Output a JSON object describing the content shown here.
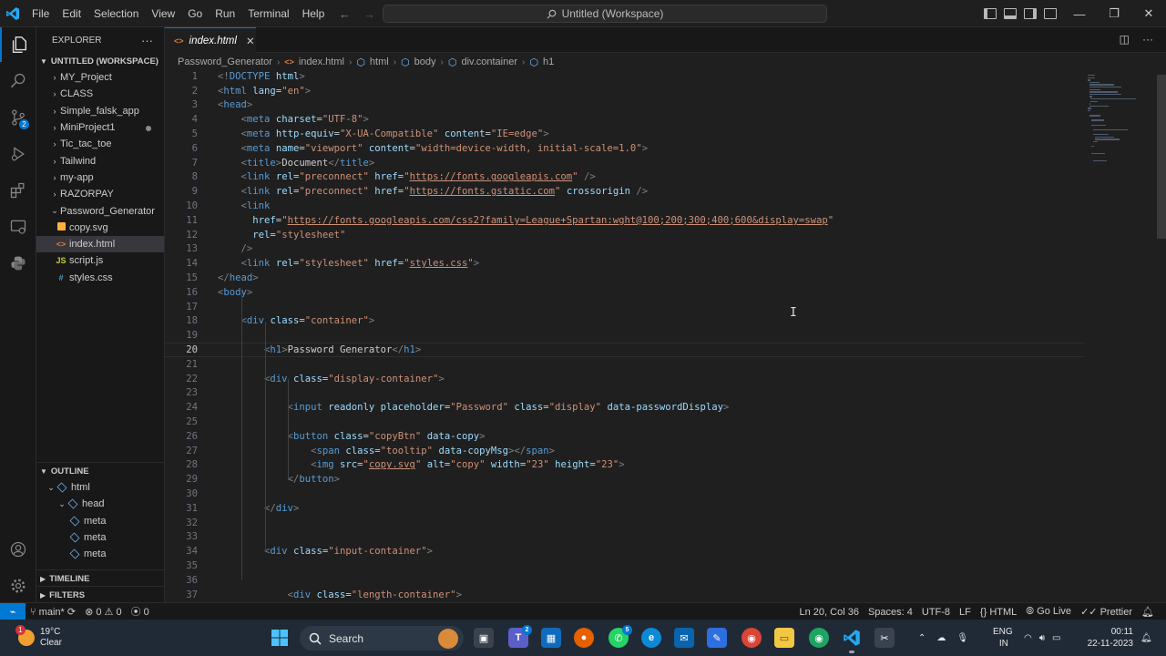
{
  "titlebar": {
    "menu": [
      "File",
      "Edit",
      "Selection",
      "View",
      "Go",
      "Run",
      "Terminal",
      "Help"
    ],
    "search_text": "Untitled (Workspace)"
  },
  "sidebar": {
    "explorer_title": "EXPLORER",
    "more": "···",
    "workspace_label": "UNTITLED (WORKSPACE)",
    "folders": [
      "MY_Project",
      "CLASS",
      "Simple_falsk_app",
      "MiniProject1",
      "Tic_tac_toe",
      "Tailwind",
      "my-app",
      "RAZORPAY"
    ],
    "open_folder": "Password_Generator",
    "files": [
      {
        "name": "copy.svg",
        "icon": "svg-icon",
        "glyph": "",
        "color": "#ffb13b"
      },
      {
        "name": "index.html",
        "icon": "html-icon",
        "glyph": "<>",
        "color": "#e37933"
      },
      {
        "name": "script.js",
        "icon": "js-icon",
        "glyph": "JS",
        "color": "#cbcb41"
      },
      {
        "name": "styles.css",
        "icon": "css-icon",
        "glyph": "#",
        "color": "#519aba"
      }
    ],
    "outline_label": "OUTLINE",
    "outline": [
      "html",
      "head",
      "meta",
      "meta",
      "meta"
    ],
    "timeline_label": "TIMELINE",
    "filters_label": "FILTERS"
  },
  "editor": {
    "tab_label": "index.html",
    "tab_close": "✕",
    "breadcrumb": [
      "Password_Generator",
      "index.html",
      "html",
      "body",
      "div.container",
      "h1"
    ],
    "current_line": 20,
    "lines": [
      [
        {
          "t": "tgb",
          "v": "<!"
        },
        {
          "t": "tg",
          "v": "DOCTYPE"
        },
        {
          "t": "tx",
          "v": " "
        },
        {
          "t": "at",
          "v": "html"
        },
        {
          "t": "tgb",
          "v": ">"
        }
      ],
      [
        {
          "t": "tgb",
          "v": "<"
        },
        {
          "t": "tg",
          "v": "html"
        },
        {
          "t": "tx",
          "v": " "
        },
        {
          "t": "at",
          "v": "lang"
        },
        {
          "t": "tx",
          "v": "="
        },
        {
          "t": "st",
          "v": "\"en\""
        },
        {
          "t": "tgb",
          "v": ">"
        }
      ],
      [
        {
          "t": "tgb",
          "v": "<"
        },
        {
          "t": "tg",
          "v": "head"
        },
        {
          "t": "tgb",
          "v": ">"
        }
      ],
      [
        {
          "t": "tx",
          "v": "    "
        },
        {
          "t": "tgb",
          "v": "<"
        },
        {
          "t": "tg",
          "v": "meta"
        },
        {
          "t": "tx",
          "v": " "
        },
        {
          "t": "at",
          "v": "charset"
        },
        {
          "t": "tx",
          "v": "="
        },
        {
          "t": "st",
          "v": "\"UTF-8\""
        },
        {
          "t": "tgb",
          "v": ">"
        }
      ],
      [
        {
          "t": "tx",
          "v": "    "
        },
        {
          "t": "tgb",
          "v": "<"
        },
        {
          "t": "tg",
          "v": "meta"
        },
        {
          "t": "tx",
          "v": " "
        },
        {
          "t": "at",
          "v": "http-equiv"
        },
        {
          "t": "tx",
          "v": "="
        },
        {
          "t": "st",
          "v": "\"X-UA-Compatible\""
        },
        {
          "t": "tx",
          "v": " "
        },
        {
          "t": "at",
          "v": "content"
        },
        {
          "t": "tx",
          "v": "="
        },
        {
          "t": "st",
          "v": "\"IE=edge\""
        },
        {
          "t": "tgb",
          "v": ">"
        }
      ],
      [
        {
          "t": "tx",
          "v": "    "
        },
        {
          "t": "tgb",
          "v": "<"
        },
        {
          "t": "tg",
          "v": "meta"
        },
        {
          "t": "tx",
          "v": " "
        },
        {
          "t": "at",
          "v": "name"
        },
        {
          "t": "tx",
          "v": "="
        },
        {
          "t": "st",
          "v": "\"viewport\""
        },
        {
          "t": "tx",
          "v": " "
        },
        {
          "t": "at",
          "v": "content"
        },
        {
          "t": "tx",
          "v": "="
        },
        {
          "t": "st",
          "v": "\"width=device-width, initial-scale=1.0\""
        },
        {
          "t": "tgb",
          "v": ">"
        }
      ],
      [
        {
          "t": "tx",
          "v": "    "
        },
        {
          "t": "tgb",
          "v": "<"
        },
        {
          "t": "tg",
          "v": "title"
        },
        {
          "t": "tgb",
          "v": ">"
        },
        {
          "t": "tx",
          "v": "Document"
        },
        {
          "t": "tgb",
          "v": "</"
        },
        {
          "t": "tg",
          "v": "title"
        },
        {
          "t": "tgb",
          "v": ">"
        }
      ],
      [
        {
          "t": "tx",
          "v": "    "
        },
        {
          "t": "tgb",
          "v": "<"
        },
        {
          "t": "tg",
          "v": "link"
        },
        {
          "t": "tx",
          "v": " "
        },
        {
          "t": "at",
          "v": "rel"
        },
        {
          "t": "tx",
          "v": "="
        },
        {
          "t": "st",
          "v": "\"preconnect\""
        },
        {
          "t": "tx",
          "v": " "
        },
        {
          "t": "at",
          "v": "href"
        },
        {
          "t": "tx",
          "v": "="
        },
        {
          "t": "st",
          "v": "\""
        },
        {
          "t": "ur",
          "v": "https://fonts.googleapis.com"
        },
        {
          "t": "st",
          "v": "\""
        },
        {
          "t": "tx",
          "v": " "
        },
        {
          "t": "tgb",
          "v": "/>"
        }
      ],
      [
        {
          "t": "tx",
          "v": "    "
        },
        {
          "t": "tgb",
          "v": "<"
        },
        {
          "t": "tg",
          "v": "link"
        },
        {
          "t": "tx",
          "v": " "
        },
        {
          "t": "at",
          "v": "rel"
        },
        {
          "t": "tx",
          "v": "="
        },
        {
          "t": "st",
          "v": "\"preconnect\""
        },
        {
          "t": "tx",
          "v": " "
        },
        {
          "t": "at",
          "v": "href"
        },
        {
          "t": "tx",
          "v": "="
        },
        {
          "t": "st",
          "v": "\""
        },
        {
          "t": "ur",
          "v": "https://fonts.gstatic.com"
        },
        {
          "t": "st",
          "v": "\""
        },
        {
          "t": "tx",
          "v": " "
        },
        {
          "t": "at",
          "v": "crossorigin"
        },
        {
          "t": "tx",
          "v": " "
        },
        {
          "t": "tgb",
          "v": "/>"
        }
      ],
      [
        {
          "t": "tx",
          "v": "    "
        },
        {
          "t": "tgb",
          "v": "<"
        },
        {
          "t": "tg",
          "v": "link"
        }
      ],
      [
        {
          "t": "tx",
          "v": "      "
        },
        {
          "t": "at",
          "v": "href"
        },
        {
          "t": "tx",
          "v": "="
        },
        {
          "t": "st",
          "v": "\""
        },
        {
          "t": "ur",
          "v": "https://fonts.googleapis.com/css2?family=League+Spartan:wght@100;200;300;400;600&display=swap"
        },
        {
          "t": "st",
          "v": "\""
        }
      ],
      [
        {
          "t": "tx",
          "v": "      "
        },
        {
          "t": "at",
          "v": "rel"
        },
        {
          "t": "tx",
          "v": "="
        },
        {
          "t": "st",
          "v": "\"stylesheet\""
        }
      ],
      [
        {
          "t": "tx",
          "v": "    "
        },
        {
          "t": "tgb",
          "v": "/>"
        }
      ],
      [
        {
          "t": "tx",
          "v": "    "
        },
        {
          "t": "tgb",
          "v": "<"
        },
        {
          "t": "tg",
          "v": "link"
        },
        {
          "t": "tx",
          "v": " "
        },
        {
          "t": "at",
          "v": "rel"
        },
        {
          "t": "tx",
          "v": "="
        },
        {
          "t": "st",
          "v": "\"stylesheet\""
        },
        {
          "t": "tx",
          "v": " "
        },
        {
          "t": "at",
          "v": "href"
        },
        {
          "t": "tx",
          "v": "="
        },
        {
          "t": "st",
          "v": "\""
        },
        {
          "t": "ur",
          "v": "styles.css"
        },
        {
          "t": "st",
          "v": "\""
        },
        {
          "t": "tgb",
          "v": ">"
        }
      ],
      [
        {
          "t": "tgb",
          "v": "</"
        },
        {
          "t": "tg",
          "v": "head"
        },
        {
          "t": "tgb",
          "v": ">"
        }
      ],
      [
        {
          "t": "tgb",
          "v": "<"
        },
        {
          "t": "tg",
          "v": "body"
        },
        {
          "t": "tgb",
          "v": ">"
        }
      ],
      [],
      [
        {
          "t": "tx",
          "v": "    "
        },
        {
          "t": "tgb",
          "v": "<"
        },
        {
          "t": "tg",
          "v": "div"
        },
        {
          "t": "tx",
          "v": " "
        },
        {
          "t": "at",
          "v": "class"
        },
        {
          "t": "tx",
          "v": "="
        },
        {
          "t": "st",
          "v": "\"container\""
        },
        {
          "t": "tgb",
          "v": ">"
        }
      ],
      [],
      [
        {
          "t": "tx",
          "v": "        "
        },
        {
          "t": "tgb",
          "v": "<"
        },
        {
          "t": "tg",
          "v": "h1"
        },
        {
          "t": "tgb",
          "v": ">"
        },
        {
          "t": "tx",
          "v": "Password Generator"
        },
        {
          "t": "tgb",
          "v": "</"
        },
        {
          "t": "tg",
          "v": "h1"
        },
        {
          "t": "tgb",
          "v": ">"
        }
      ],
      [],
      [
        {
          "t": "tx",
          "v": "        "
        },
        {
          "t": "tgb",
          "v": "<"
        },
        {
          "t": "tg",
          "v": "div"
        },
        {
          "t": "tx",
          "v": " "
        },
        {
          "t": "at",
          "v": "class"
        },
        {
          "t": "tx",
          "v": "="
        },
        {
          "t": "st",
          "v": "\"display-container\""
        },
        {
          "t": "tgb",
          "v": ">"
        }
      ],
      [],
      [
        {
          "t": "tx",
          "v": "            "
        },
        {
          "t": "tgb",
          "v": "<"
        },
        {
          "t": "tg",
          "v": "input"
        },
        {
          "t": "tx",
          "v": " "
        },
        {
          "t": "at",
          "v": "readonly"
        },
        {
          "t": "tx",
          "v": " "
        },
        {
          "t": "at",
          "v": "placeholder"
        },
        {
          "t": "tx",
          "v": "="
        },
        {
          "t": "st",
          "v": "\"Password\""
        },
        {
          "t": "tx",
          "v": " "
        },
        {
          "t": "at",
          "v": "class"
        },
        {
          "t": "tx",
          "v": "="
        },
        {
          "t": "st",
          "v": "\"display\""
        },
        {
          "t": "tx",
          "v": " "
        },
        {
          "t": "at",
          "v": "data-passwordDisplay"
        },
        {
          "t": "tgb",
          "v": ">"
        }
      ],
      [],
      [
        {
          "t": "tx",
          "v": "            "
        },
        {
          "t": "tgb",
          "v": "<"
        },
        {
          "t": "tg",
          "v": "button"
        },
        {
          "t": "tx",
          "v": " "
        },
        {
          "t": "at",
          "v": "class"
        },
        {
          "t": "tx",
          "v": "="
        },
        {
          "t": "st",
          "v": "\"copyBtn\""
        },
        {
          "t": "tx",
          "v": " "
        },
        {
          "t": "at",
          "v": "data-copy"
        },
        {
          "t": "tgb",
          "v": ">"
        }
      ],
      [
        {
          "t": "tx",
          "v": "                "
        },
        {
          "t": "tgb",
          "v": "<"
        },
        {
          "t": "tg",
          "v": "span"
        },
        {
          "t": "tx",
          "v": " "
        },
        {
          "t": "at",
          "v": "class"
        },
        {
          "t": "tx",
          "v": "="
        },
        {
          "t": "st",
          "v": "\"tooltip\""
        },
        {
          "t": "tx",
          "v": " "
        },
        {
          "t": "at",
          "v": "data-copyMsg"
        },
        {
          "t": "tgb",
          "v": "></"
        },
        {
          "t": "tg",
          "v": "span"
        },
        {
          "t": "tgb",
          "v": ">"
        }
      ],
      [
        {
          "t": "tx",
          "v": "                "
        },
        {
          "t": "tgb",
          "v": "<"
        },
        {
          "t": "tg",
          "v": "img"
        },
        {
          "t": "tx",
          "v": " "
        },
        {
          "t": "at",
          "v": "src"
        },
        {
          "t": "tx",
          "v": "="
        },
        {
          "t": "st",
          "v": "\""
        },
        {
          "t": "ur",
          "v": "copy.svg"
        },
        {
          "t": "st",
          "v": "\""
        },
        {
          "t": "tx",
          "v": " "
        },
        {
          "t": "at",
          "v": "alt"
        },
        {
          "t": "tx",
          "v": "="
        },
        {
          "t": "st",
          "v": "\"copy\""
        },
        {
          "t": "tx",
          "v": " "
        },
        {
          "t": "at",
          "v": "width"
        },
        {
          "t": "tx",
          "v": "="
        },
        {
          "t": "st",
          "v": "\"23\""
        },
        {
          "t": "tx",
          "v": " "
        },
        {
          "t": "at",
          "v": "height"
        },
        {
          "t": "tx",
          "v": "="
        },
        {
          "t": "st",
          "v": "\"23\""
        },
        {
          "t": "tgb",
          "v": ">"
        }
      ],
      [
        {
          "t": "tx",
          "v": "            "
        },
        {
          "t": "tgb",
          "v": "</"
        },
        {
          "t": "tg",
          "v": "button"
        },
        {
          "t": "tgb",
          "v": ">"
        }
      ],
      [],
      [
        {
          "t": "tx",
          "v": "        "
        },
        {
          "t": "tgb",
          "v": "</"
        },
        {
          "t": "tg",
          "v": "div"
        },
        {
          "t": "tgb",
          "v": ">"
        }
      ],
      [],
      [],
      [
        {
          "t": "tx",
          "v": "        "
        },
        {
          "t": "tgb",
          "v": "<"
        },
        {
          "t": "tg",
          "v": "div"
        },
        {
          "t": "tx",
          "v": " "
        },
        {
          "t": "at",
          "v": "class"
        },
        {
          "t": "tx",
          "v": "="
        },
        {
          "t": "st",
          "v": "\"input-container\""
        },
        {
          "t": "tgb",
          "v": ">"
        }
      ],
      [],
      [],
      [
        {
          "t": "tx",
          "v": "            "
        },
        {
          "t": "tgb",
          "v": "<"
        },
        {
          "t": "tg",
          "v": "div"
        },
        {
          "t": "tx",
          "v": " "
        },
        {
          "t": "at",
          "v": "class"
        },
        {
          "t": "tx",
          "v": "="
        },
        {
          "t": "st",
          "v": "\"length-container\""
        },
        {
          "t": "tgb",
          "v": ">"
        }
      ]
    ]
  },
  "statusbar": {
    "branch": "main*",
    "errors": "0",
    "warnings": "0",
    "ports": "0",
    "position": "Ln 20, Col 36",
    "spaces": "Spaces: 4",
    "encoding": "UTF-8",
    "eol": "LF",
    "language": "HTML",
    "golive": "Go Live",
    "prettier": "Prettier"
  },
  "taskbar": {
    "weather_badge": "1",
    "temperature": "19°C",
    "condition": "Clear",
    "search_label": "Search",
    "lang": "ENG",
    "region": "IN",
    "time": "00:11",
    "date": "22-11-2023",
    "teams_badge": "2",
    "whatsapp_badge": "5"
  },
  "colors": {
    "accent": "#0078d4",
    "editor_bg": "#1f1f1f",
    "sidebar_bg": "#181818",
    "taskbar_bg": "#202a36"
  }
}
